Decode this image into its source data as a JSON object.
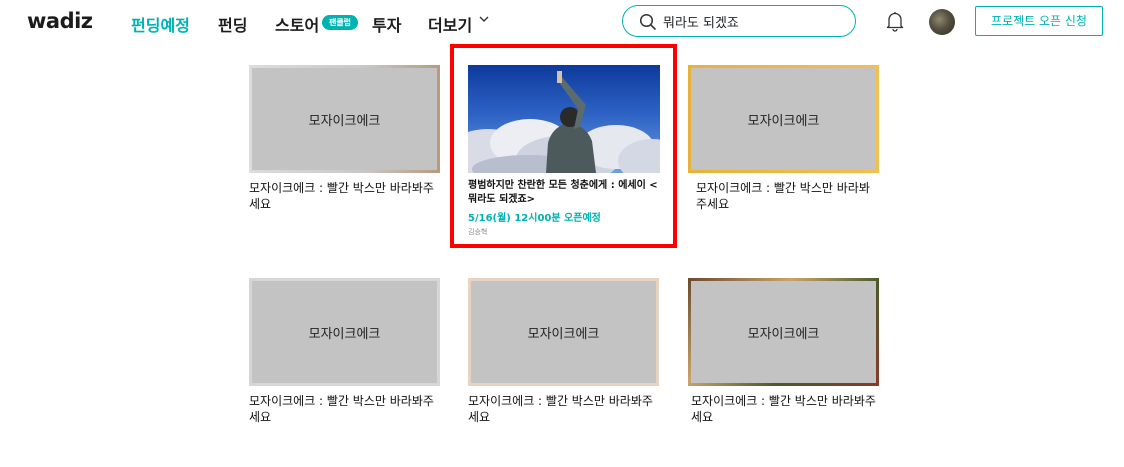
{
  "header": {
    "logo": "wadiz",
    "nav": [
      "펀딩예정",
      "펀딩",
      "스토어",
      "투자",
      "더보기"
    ],
    "store_badge": "팬클럽",
    "search_value": "뭐라도 되겠죠",
    "open_button": "프로젝트 오픈 신청"
  },
  "featured": {
    "title": "평범하지만 찬란한 모든 청춘에게 : 에세이 <뭐라도 되겠죠>",
    "date": "5/16(월) 12시00분 오픈예정",
    "maker": "김승혁"
  },
  "mosaic_cards": [
    {
      "label": "모자이크에크",
      "title": "모자이크에크 :  빨간 박스만 바라봐주세요"
    },
    {
      "label": "모자이크에크",
      "title": "모자이크에크 :  빨간 박스만 바라봐주세요"
    },
    {
      "label": "모자이크에크",
      "title": "모자이크에크 :  빨간 박스만 바라봐주세요"
    },
    {
      "label": "모자이크에크",
      "title": "모자이크에크 :  빨간 박스만 바라봐주세요"
    },
    {
      "label": "모자이크에크",
      "title": "모자이크에크 :  빨간 박스만 바라봐주세요"
    }
  ],
  "colors": {
    "accent": "#00b2b2",
    "highlight": "#ff0000",
    "mosaic": "#c3c3c3"
  },
  "icons": [
    "search-icon",
    "chevron-down-icon",
    "bell-icon"
  ]
}
